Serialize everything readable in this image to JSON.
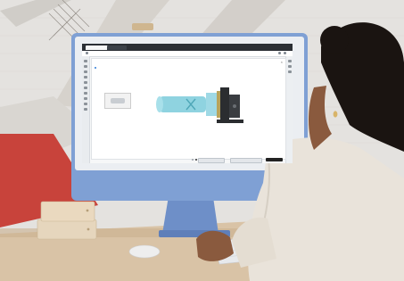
{
  "scene": {
    "description_tag": "office",
    "colors": {
      "wall": "#e4e2df",
      "stair_beam": "#d0cdc8",
      "red_wall": "#c8433b",
      "desk": "#d9c3a6",
      "monitor_blue": "#7fa0d4",
      "monitor_bezel": "#ebeef2",
      "person_hair": "#1a1411",
      "person_shirt": "#e9e3da",
      "skin": "#8a5a3e",
      "box": "#e6d6bd",
      "keyboard": "#e7e9ec",
      "mouse": "#eeeeee",
      "model_cyan": "#8fd3e0",
      "model_dark": "#2b2d30",
      "model_gold": "#b8a35a"
    }
  },
  "screen": {
    "tabs": [
      "",
      ""
    ],
    "panel_title": "",
    "lines": [
      "",
      ""
    ],
    "footer_text": "",
    "buttons": [
      "",
      "",
      ""
    ],
    "carousel_count": 4,
    "carousel_active": 1
  }
}
